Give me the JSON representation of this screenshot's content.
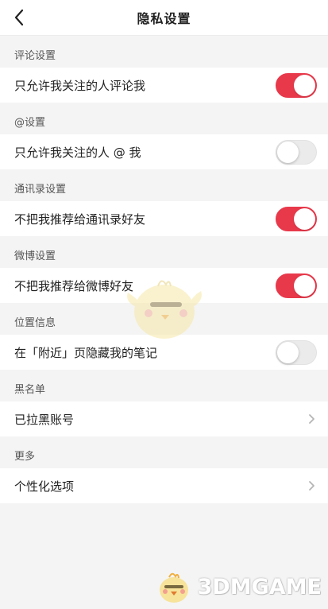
{
  "header": {
    "title": "隐私设置",
    "back_icon": "chevron-left-icon"
  },
  "accent_color": "#e8394b",
  "sections": [
    {
      "label": "评论设置",
      "row": {
        "label": "只允许我关注的人评论我",
        "control": "toggle",
        "on": true
      }
    },
    {
      "label": "@设置",
      "row": {
        "label": "只允许我关注的人 @ 我",
        "control": "toggle",
        "on": false
      }
    },
    {
      "label": "通讯录设置",
      "row": {
        "label": "不把我推荐给通讯录好友",
        "control": "toggle",
        "on": true
      }
    },
    {
      "label": "微博设置",
      "row": {
        "label": "不把我推荐给微博好友",
        "control": "toggle",
        "on": true
      }
    },
    {
      "label": "位置信息",
      "row": {
        "label": "在「附近」页隐藏我的笔记",
        "control": "toggle",
        "on": false
      }
    },
    {
      "label": "黑名单",
      "row": {
        "label": "已拉黑账号",
        "control": "chevron"
      }
    },
    {
      "label": "更多",
      "row": {
        "label": "个性化选项",
        "control": "chevron"
      }
    }
  ],
  "watermark": {
    "text": "3DMGAME"
  }
}
